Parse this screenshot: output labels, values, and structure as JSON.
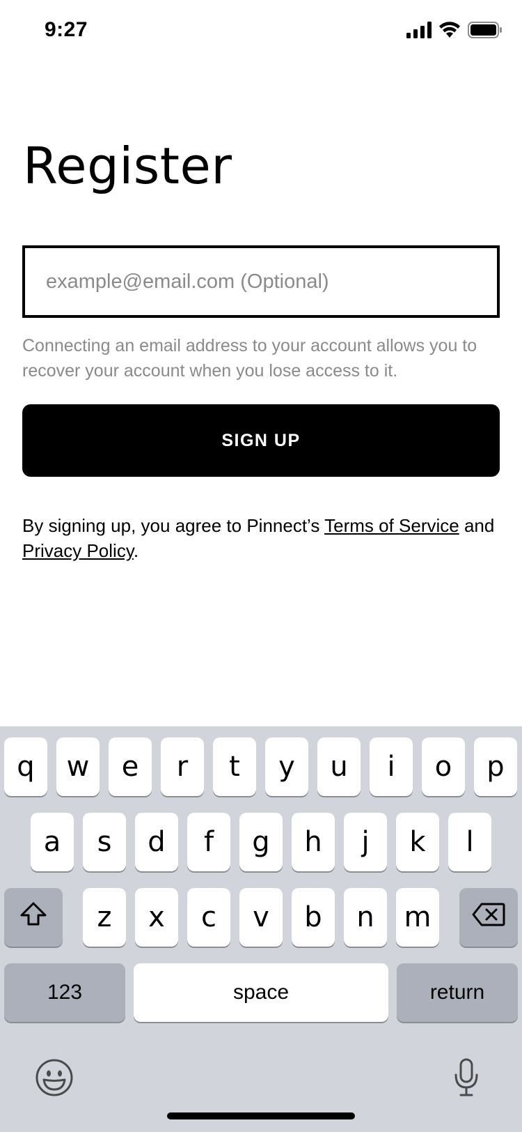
{
  "status_bar": {
    "time": "9:27"
  },
  "page": {
    "title": "Register"
  },
  "email": {
    "placeholder": "example@email.com (Optional)",
    "value": ""
  },
  "help_text": "Connecting an email address to your account allows you to recover your account when you lose access to it.",
  "signup": {
    "label": "SIGN UP"
  },
  "legal": {
    "prefix": "By signing up, you agree to Pinnect’s ",
    "terms_link": "Terms of Service",
    "middle": " and ",
    "privacy_link": "Privacy Policy",
    "suffix": "."
  },
  "keyboard": {
    "row1": [
      "q",
      "w",
      "e",
      "r",
      "t",
      "y",
      "u",
      "i",
      "o",
      "p"
    ],
    "row2": [
      "a",
      "s",
      "d",
      "f",
      "g",
      "h",
      "j",
      "k",
      "l"
    ],
    "row3": [
      "z",
      "x",
      "c",
      "v",
      "b",
      "n",
      "m"
    ],
    "numbers_label": "123",
    "space_label": "space",
    "return_label": "return"
  },
  "icons": {
    "signal": "cellular-signal-icon",
    "wifi": "wifi-icon",
    "battery": "battery-icon",
    "shift": "shift-icon",
    "delete": "delete-icon",
    "emoji": "emoji-icon",
    "mic": "microphone-icon"
  }
}
